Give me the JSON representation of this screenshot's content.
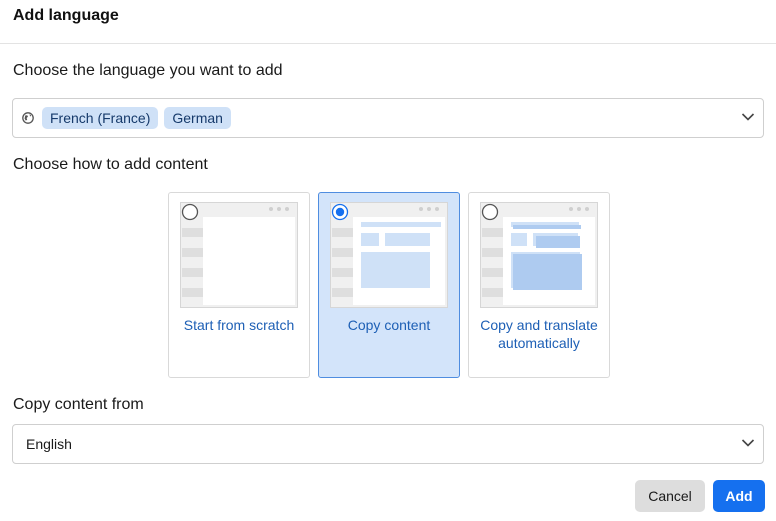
{
  "dialog": {
    "title": "Add language"
  },
  "language_section": {
    "label": "Choose the language you want to add",
    "selected_languages": [
      "French (France)",
      "German"
    ],
    "icon": "globe-icon"
  },
  "content_section": {
    "label": "Choose how to add content",
    "options": [
      {
        "label": "Start from scratch",
        "selected": false
      },
      {
        "label": "Copy content",
        "selected": true
      },
      {
        "label": "Copy and translate automatically",
        "selected": false
      }
    ]
  },
  "copy_from_section": {
    "label": "Copy content from",
    "value": "English"
  },
  "footer": {
    "cancel_label": "Cancel",
    "add_label": "Add"
  },
  "colors": {
    "accent": "#1570ef",
    "chip_bg": "#cfe1f7",
    "selected_card_bg": "#d3e4fa",
    "option_label": "#1d5fb5"
  }
}
